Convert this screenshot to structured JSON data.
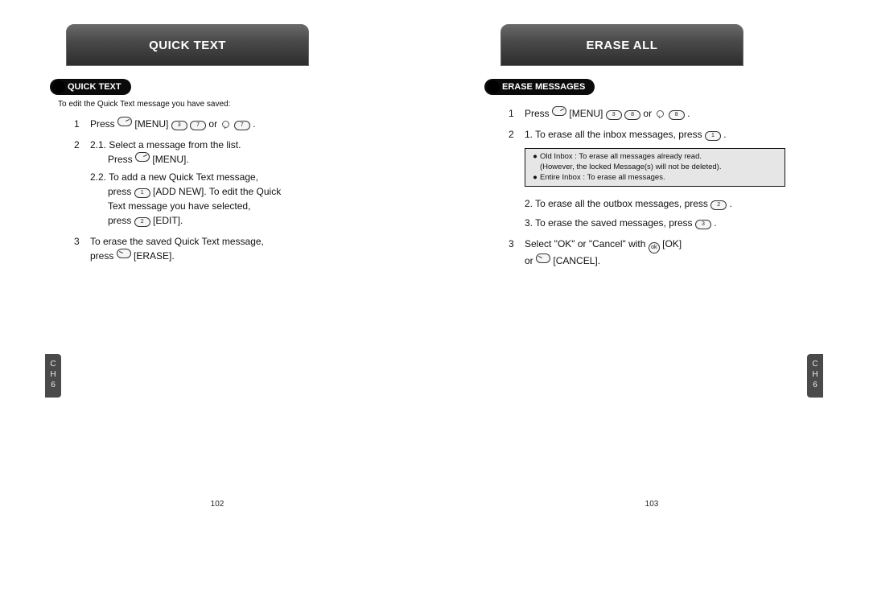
{
  "left": {
    "tab_title": "QUICK TEXT",
    "section_label": "QUICK TEXT",
    "intro": "To edit the Quick Text message you have saved:",
    "step1_a": "Press ",
    "step1_menu": " [MENU] ",
    "step1_b": " or ",
    "step1_c": " .",
    "step2_1a": "2.1. Select a message from the list.",
    "step2_1b": "Press ",
    "step2_1c": " [MENU].",
    "step2_2a": "2.2. To add a new Quick Text message,",
    "step2_2b": "press ",
    "step2_2c": " [ADD NEW]. To edit the Quick",
    "step2_2d": "Text message you have selected,",
    "step2_2e": "press ",
    "step2_2f": " [EDIT].",
    "step3_a": "To erase the saved Quick Text message,",
    "step3_b": "press ",
    "step3_c": " [ERASE].",
    "page_num": "102"
  },
  "right": {
    "tab_title": "ERASE ALL",
    "section_label": "ERASE MESSAGES",
    "step1_a": "Press ",
    "step1_menu": " [MENU] ",
    "step1_b": " or ",
    "step1_c": " .",
    "step2_1": "1. To erase all the inbox messages, press ",
    "step2_1b": " .",
    "note_line1": "Old Inbox : To erase all messages already read.",
    "note_line1b": "(However, the locked Message(s) will not be deleted).",
    "note_line2": "Entire Inbox : To erase all messages.",
    "step2_2": "2. To erase all the outbox messages, press ",
    "step2_2b": " .",
    "step2_3": "3. To erase the saved messages, press ",
    "step2_3b": " .",
    "step3_a": "Select \"OK\" or \"Cancel\" with ",
    "step3_b": " [OK]",
    "step3_c": "or ",
    "step3_d": " [CANCEL].",
    "page_num": "103"
  },
  "chapter_label": "C\nH\n6"
}
